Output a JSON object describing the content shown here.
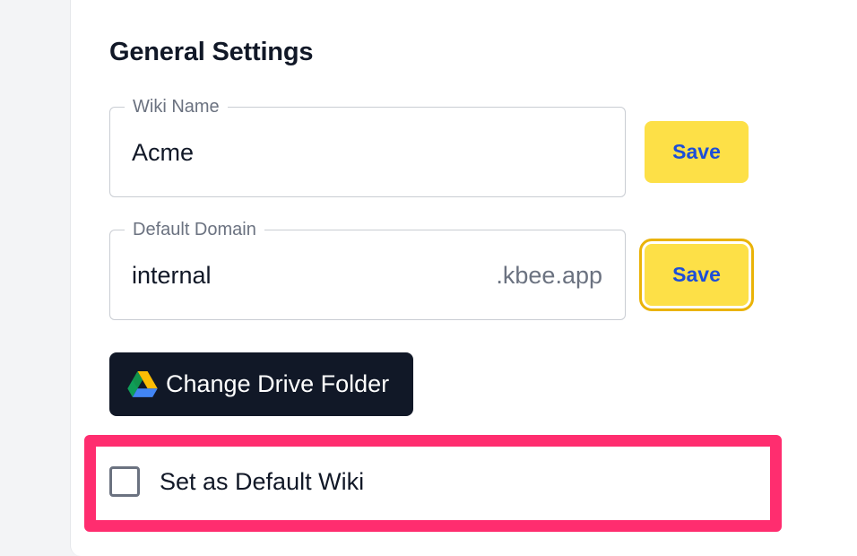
{
  "section": {
    "title": "General Settings"
  },
  "wiki_name": {
    "label": "Wiki Name",
    "value": "Acme",
    "save_label": "Save"
  },
  "default_domain": {
    "label": "Default Domain",
    "value": "internal",
    "suffix": ".kbee.app",
    "save_label": "Save"
  },
  "drive": {
    "button_label": "Change Drive Folder",
    "icon": "google-drive-icon"
  },
  "default_wiki": {
    "label": "Set as Default Wiki",
    "checked": false
  },
  "colors": {
    "save_button": "#fde047",
    "save_text": "#1d4ed8",
    "drive_button": "#111827",
    "highlight": "#ff2d6f"
  }
}
